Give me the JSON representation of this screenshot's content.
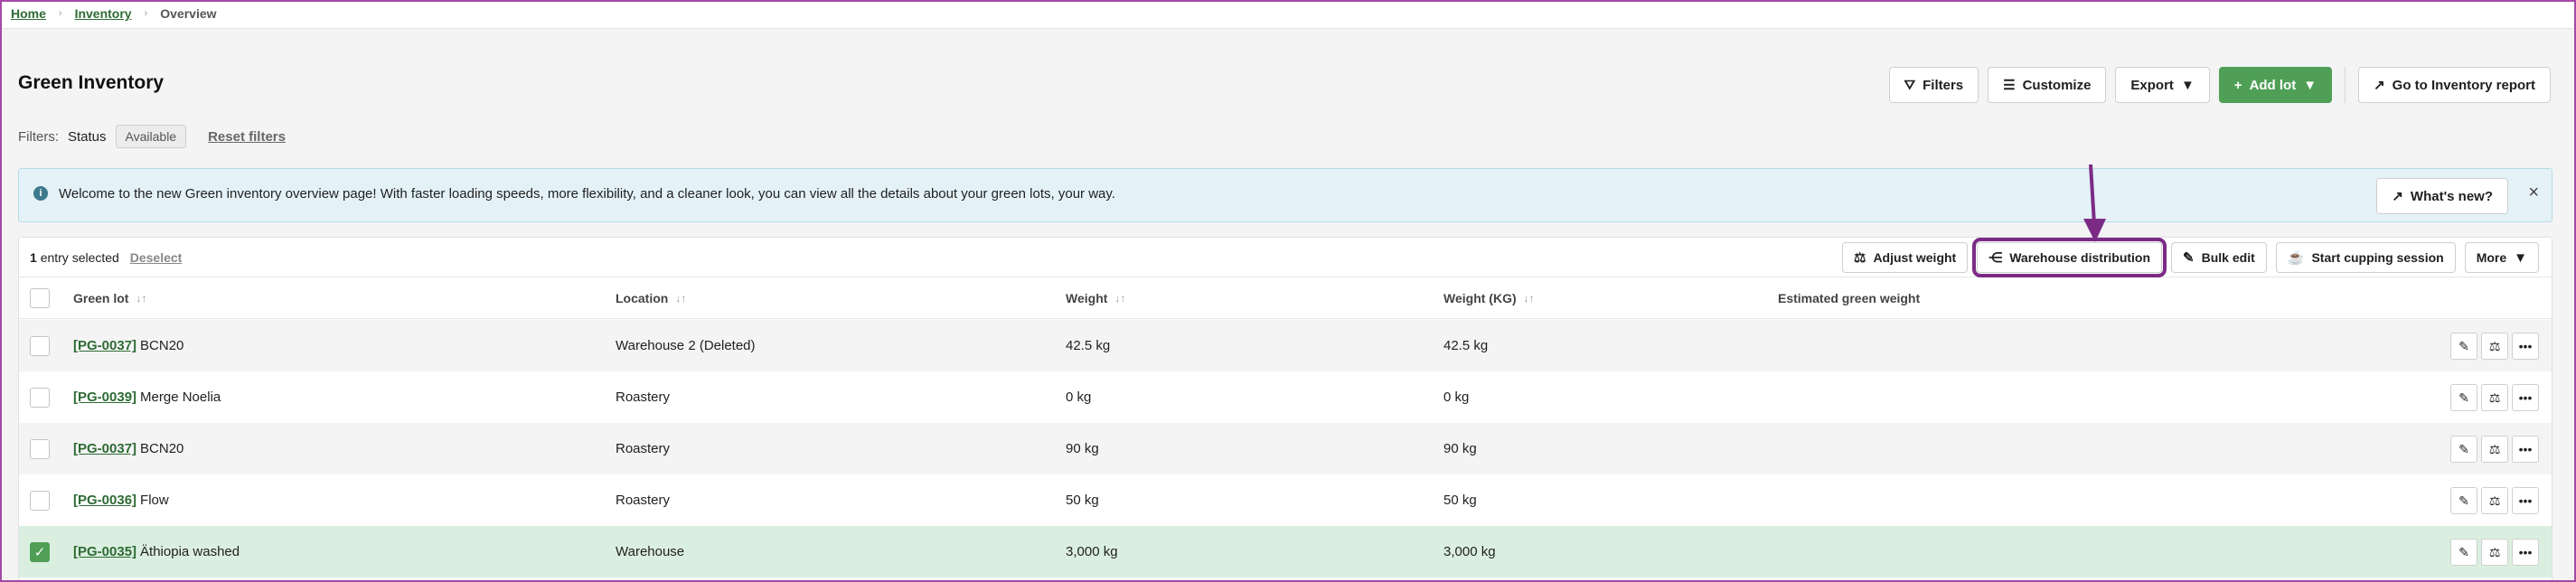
{
  "breadcrumb": {
    "home": "Home",
    "inventory": "Inventory",
    "current": "Overview",
    "sep": "›"
  },
  "page": {
    "title": "Green Inventory"
  },
  "toolbar": {
    "filters": "Filters",
    "customize": "Customize",
    "export": "Export",
    "add_lot": "Add lot",
    "go_report": "Go to Inventory report"
  },
  "filters": {
    "label": "Filters:",
    "status_label": "Status",
    "status_value": "Available",
    "reset": "Reset filters"
  },
  "banner": {
    "message": "Welcome to the new Green inventory overview page! With faster loading speeds, more flexibility, and a cleaner look, you can view all the details about your green lots, your way.",
    "whats_new": "What's new?"
  },
  "selection": {
    "count": "1",
    "suffix": "entry selected",
    "deselect": "Deselect",
    "actions": {
      "adjust_weight": "Adjust weight",
      "warehouse_distribution": "Warehouse distribution",
      "bulk_edit": "Bulk edit",
      "start_cupping": "Start cupping session",
      "more": "More"
    }
  },
  "table": {
    "headers": {
      "green_lot": "Green lot",
      "location": "Location",
      "weight": "Weight",
      "weight_kg": "Weight (KG)",
      "estimated": "Estimated green weight"
    },
    "rows": [
      {
        "id": "[PG-0037]",
        "name": "BCN20",
        "location": "Warehouse 2 (Deleted)",
        "weight": "42.5 kg",
        "weight_kg": "42.5 kg"
      },
      {
        "id": "[PG-0039]",
        "name": "Merge Noelia",
        "location": "Roastery",
        "weight": "0 kg",
        "weight_kg": "0 kg"
      },
      {
        "id": "[PG-0037]",
        "name": "BCN20",
        "location": "Roastery",
        "weight": "90 kg",
        "weight_kg": "90 kg"
      },
      {
        "id": "[PG-0036]",
        "name": "Flow",
        "location": "Roastery",
        "weight": "50 kg",
        "weight_kg": "50 kg"
      },
      {
        "id": "[PG-0035]",
        "name": "Äthiopia washed",
        "location": "Warehouse",
        "weight": "3,000 kg",
        "weight_kg": "3,000 kg"
      }
    ]
  },
  "colors": {
    "accent_green": "#4f9f57",
    "link_green": "#2e6b34",
    "highlight_purple": "#7b2b86"
  }
}
